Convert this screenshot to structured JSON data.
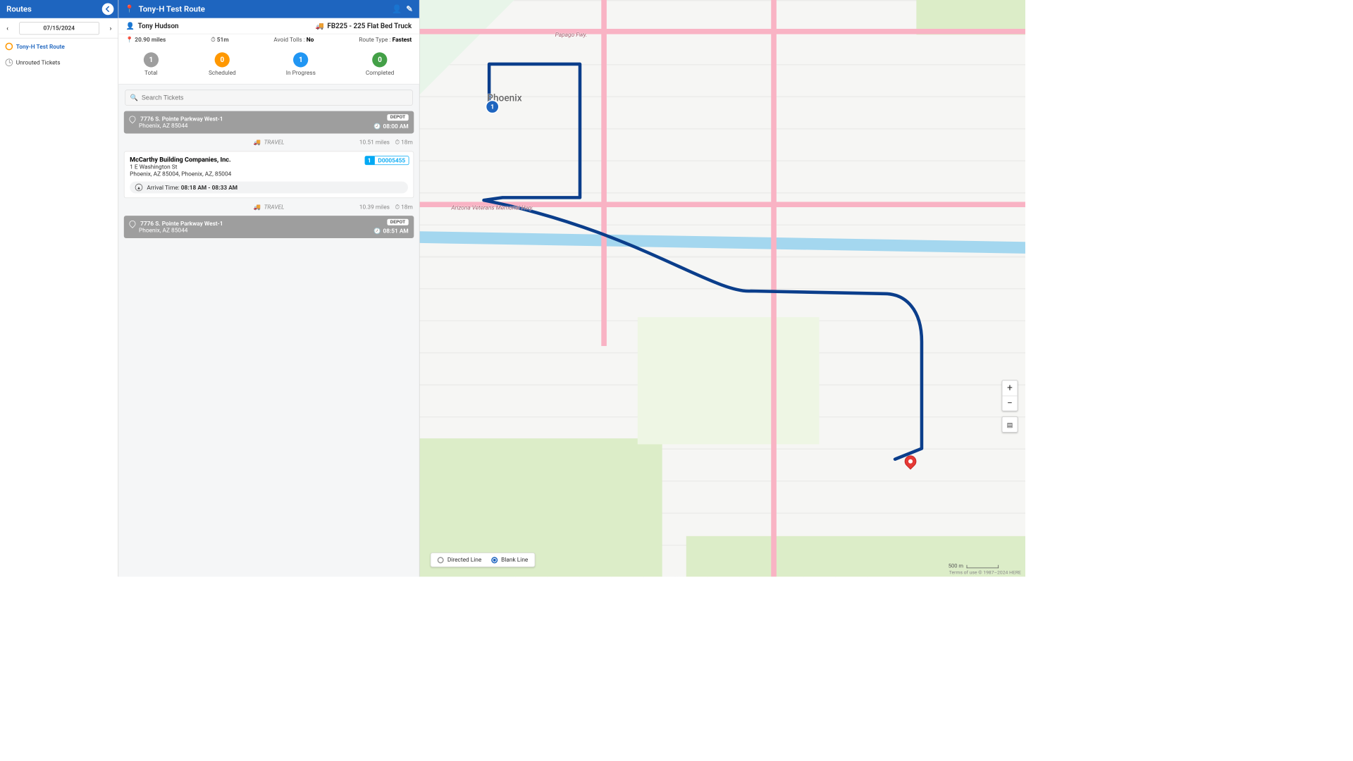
{
  "sidebar": {
    "title": "Routes",
    "date": "07/15/2024",
    "items": [
      {
        "label": "Tony-H Test Route"
      },
      {
        "label": "Unrouted Tickets"
      }
    ]
  },
  "panel": {
    "title": "Tony-H Test Route",
    "driver": "Tony Hudson",
    "vehicle": "FB225 - 225 Flat Bed Truck",
    "distance": "20.90 miles",
    "duration": "51m",
    "avoid_tolls_label": "Avoid Tolls :",
    "avoid_tolls_value": "No",
    "route_type_label": "Route Type :",
    "route_type_value": "Fastest",
    "status": [
      {
        "count": "1",
        "label": "Total",
        "cls": "b-grey"
      },
      {
        "count": "0",
        "label": "Scheduled",
        "cls": "b-orange"
      },
      {
        "count": "1",
        "label": "In Progress",
        "cls": "b-blue"
      },
      {
        "count": "0",
        "label": "Completed",
        "cls": "b-green"
      }
    ],
    "search_placeholder": "Search Tickets",
    "depot_badge": "DEPOT",
    "travel_label": "TRAVEL",
    "arrival_label": "Arrival Time:",
    "depot_start": {
      "addr1": "7776 S. Pointe Parkway West-1",
      "addr2": "Phoenix, AZ 85044",
      "time": "08:00 AM"
    },
    "travel1": {
      "dist": "10.51 miles",
      "dur": "18m"
    },
    "stop": {
      "company": "McCarthy Building Companies, Inc.",
      "addr1": "1 E Washington St",
      "addr2": "Phoenix, AZ 85004, Phoenix, AZ, 85004",
      "seq": "1",
      "ticket": "D0005455",
      "arrival": "08:18 AM - 08:33 AM"
    },
    "travel2": {
      "dist": "10.39 miles",
      "dur": "18m"
    },
    "depot_end": {
      "addr1": "7776 S. Pointe Parkway West-1",
      "addr2": "Phoenix, AZ 85044",
      "time": "08:51 AM"
    }
  },
  "map": {
    "city": "Phoenix",
    "papago": "Papago Fwy.",
    "veterans": "Arizona Veterans Memorial Hwy.",
    "toggle": {
      "opt1": "Directed Line",
      "opt2": "Blank Line"
    },
    "scale": "500 m",
    "attrib": "Terms of use   © 1987–2024 HERE"
  }
}
